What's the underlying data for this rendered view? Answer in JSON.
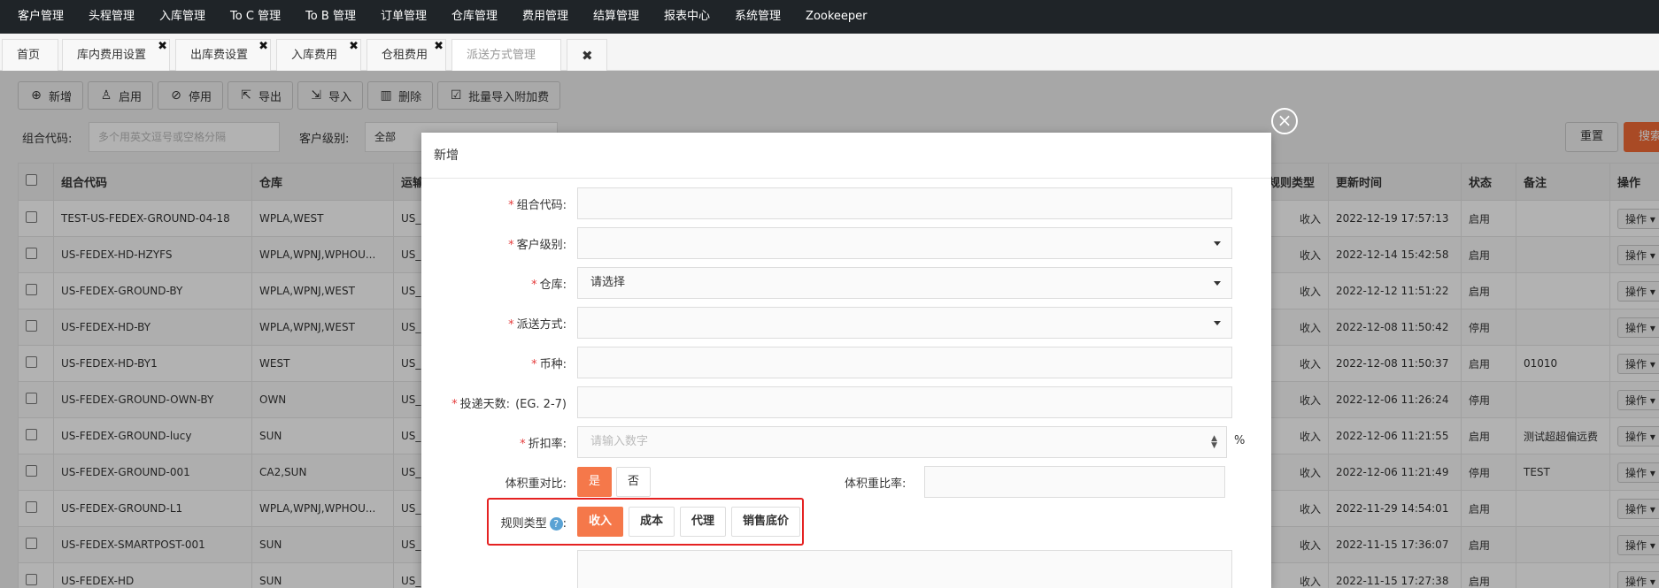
{
  "topnav": [
    "客户管理",
    "头程管理",
    "入库管理",
    "To C 管理",
    "To B 管理",
    "订单管理",
    "仓库管理",
    "费用管理",
    "结算管理",
    "报表中心",
    "系统管理",
    "Zookeeper"
  ],
  "tabs": {
    "home": "首页",
    "items": [
      "库内费用设置",
      "出库费设置",
      "入库费用",
      "仓租费用",
      "派送方式管理"
    ],
    "close_glyph": "✖"
  },
  "toolbar": {
    "add": "新增",
    "enable": "启用",
    "disable": "停用",
    "export": "导出",
    "import": "导入",
    "delete": "删除",
    "batch": "批量导入附加费"
  },
  "filters": {
    "combo_label": "组合代码:",
    "combo_placeholder": "多个用英文逗号或空格分隔",
    "level_label": "客户级别:",
    "level_value": "全部",
    "reset": "重置",
    "search": "搜索"
  },
  "table": {
    "headers": [
      "组合代码",
      "仓库",
      "运输",
      "规则类型",
      "更新时间",
      "状态",
      "备注",
      "操作"
    ],
    "op_label": "操作 ▾",
    "rows": [
      {
        "code": "TEST-US-FEDEX-GROUND-04-18",
        "wh": "WPLA,WEST",
        "tr": "US_F",
        "type": "收入",
        "time": "2022-12-19 17:57:13",
        "status": "启用",
        "note": ""
      },
      {
        "code": "US-FEDEX-HD-HZYFS",
        "wh": "WPLA,WPNJ,WPHOU...",
        "tr": "US_F",
        "type": "收入",
        "time": "2022-12-14 15:42:58",
        "status": "启用",
        "note": ""
      },
      {
        "code": "US-FEDEX-GROUND-BY",
        "wh": "WPLA,WPNJ,WEST",
        "tr": "US_F",
        "type": "收入",
        "time": "2022-12-12 11:51:22",
        "status": "启用",
        "note": ""
      },
      {
        "code": "US-FEDEX-HD-BY",
        "wh": "WPLA,WPNJ,WEST",
        "tr": "US_F",
        "type": "收入",
        "time": "2022-12-08 11:50:42",
        "status": "停用",
        "note": ""
      },
      {
        "code": "US-FEDEX-HD-BY1",
        "wh": "WEST",
        "tr": "US_F",
        "type": "收入",
        "time": "2022-12-08 11:50:37",
        "status": "启用",
        "note": "01010"
      },
      {
        "code": "US-FEDEX-GROUND-OWN-BY",
        "wh": "OWN",
        "tr": "US_F",
        "type": "收入",
        "time": "2022-12-06 11:26:24",
        "status": "停用",
        "note": ""
      },
      {
        "code": "US-FEDEX-GROUND-lucy",
        "wh": "SUN",
        "tr": "US_F",
        "type": "收入",
        "time": "2022-12-06 11:21:55",
        "status": "启用",
        "note": "测试超超偏远费"
      },
      {
        "code": "US-FEDEX-GROUND-001",
        "wh": "CA2,SUN",
        "tr": "US_F",
        "type": "收入",
        "time": "2022-12-06 11:21:49",
        "status": "停用",
        "note": "TEST"
      },
      {
        "code": "US-FEDEX-GROUND-L1",
        "wh": "WPLA,WPNJ,WPHOU...",
        "tr": "US_F",
        "type": "收入",
        "time": "2022-11-29 14:54:01",
        "status": "启用",
        "note": ""
      },
      {
        "code": "US-FEDEX-SMARTPOST-001",
        "wh": "SUN",
        "tr": "US_F",
        "type": "收入",
        "time": "2022-11-15 17:36:07",
        "status": "启用",
        "note": ""
      },
      {
        "code": "US-FEDEX-HD",
        "wh": "SUN",
        "tr": "US_F",
        "type": "收入",
        "time": "2022-11-15 17:27:38",
        "status": "启用",
        "note": ""
      }
    ]
  },
  "modal": {
    "title": "新增",
    "close_glyph": "×",
    "combo_label": "组合代码:",
    "level_label": "客户级别:",
    "wh_label": "仓库:",
    "wh_value": "请选择",
    "ship_label": "派送方式:",
    "currency_label": "币种:",
    "days_label": "投递天数:",
    "days_hint": "(EG. 2-7)",
    "discount_label": "折扣率:",
    "discount_placeholder": "请输入数字",
    "pct": "%",
    "vol_label": "体积重对比:",
    "vol_yes": "是",
    "vol_no": "否",
    "vol_ratio_label": "体积重比率:",
    "rule_label": "规则类型",
    "rule_q": "?",
    "rule_colon": ":",
    "rule_options": [
      "收入",
      "成本",
      "代理",
      "销售底价"
    ],
    "req": "*"
  }
}
